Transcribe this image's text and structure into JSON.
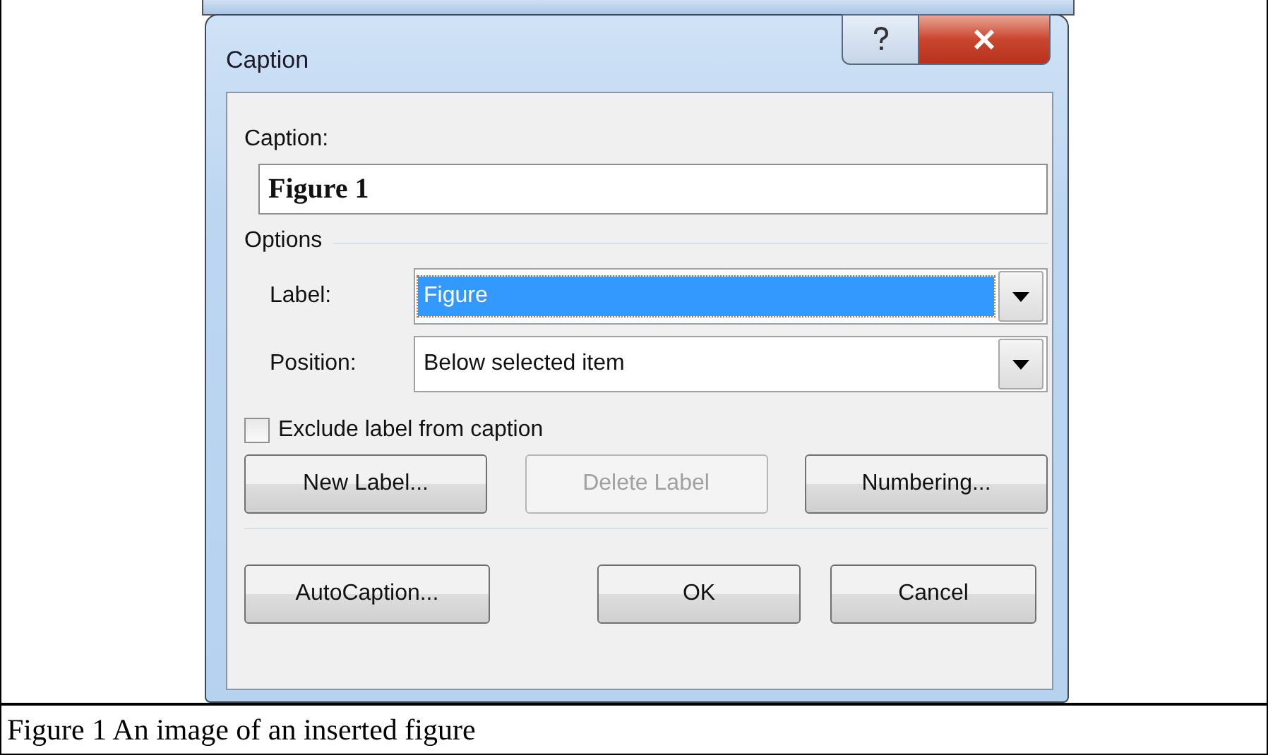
{
  "dialog": {
    "title": "Caption",
    "caption_field": {
      "label": "Caption:",
      "value": "Figure 1"
    },
    "options": {
      "heading": "Options",
      "fields": [
        {
          "label": "Label:",
          "value": "Figure",
          "selected": true
        },
        {
          "label": "Position:",
          "value": "Below selected item",
          "selected": false
        }
      ]
    },
    "exclude_checkbox": {
      "label": "Exclude label from caption",
      "checked": false
    },
    "label_buttons": [
      {
        "label": "New Label...",
        "disabled": false
      },
      {
        "label": "Delete Label",
        "disabled": true
      },
      {
        "label": "Numbering...",
        "disabled": false
      }
    ],
    "footer_buttons": [
      {
        "label": "AutoCaption...",
        "disabled": false
      },
      {
        "label": "OK",
        "disabled": false
      },
      {
        "label": "Cancel",
        "disabled": false
      }
    ]
  },
  "document_caption": "Figure 1 An image of an inserted figure"
}
